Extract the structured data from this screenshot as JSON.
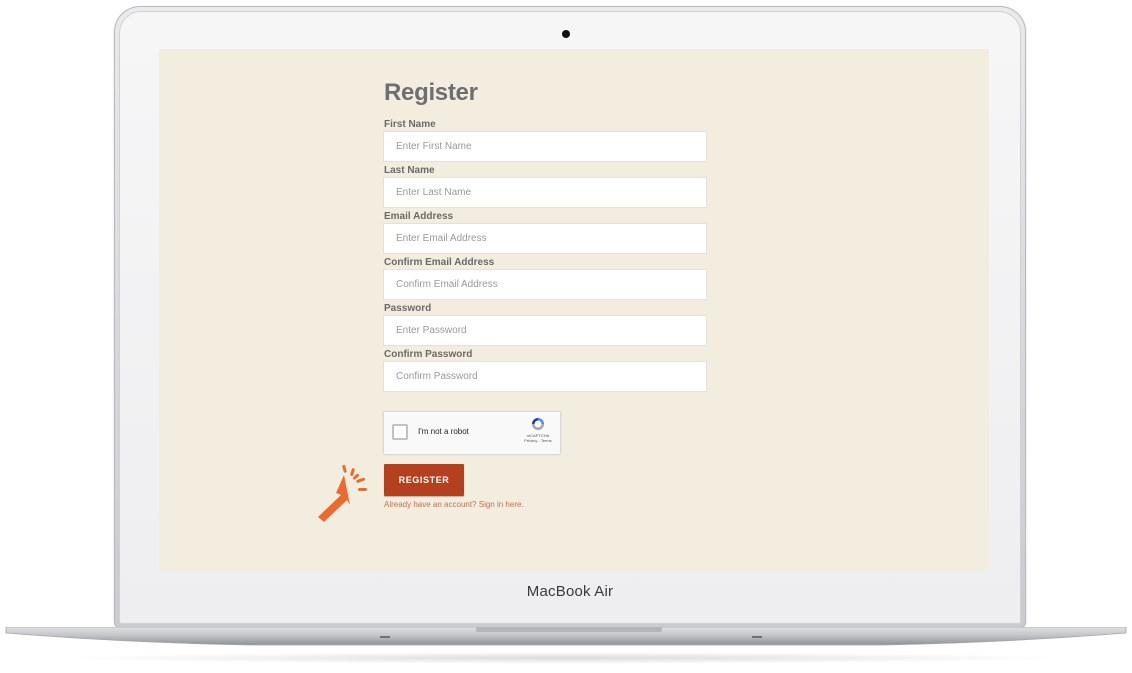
{
  "device": {
    "brand_label": "MacBook Air"
  },
  "form": {
    "title": "Register",
    "fields": [
      {
        "label": "First Name",
        "placeholder": "Enter First Name"
      },
      {
        "label": "Last Name",
        "placeholder": "Enter Last Name"
      },
      {
        "label": "Email Address",
        "placeholder": "Enter Email Address"
      },
      {
        "label": "Confirm Email Address",
        "placeholder": "Confirm Email Address"
      },
      {
        "label": "Password",
        "placeholder": "Enter Password"
      },
      {
        "label": "Confirm Password",
        "placeholder": "Confirm Password"
      }
    ],
    "recaptcha": {
      "label": "I'm not a robot",
      "brand": "reCAPTCHA",
      "terms": "Privacy - Terms"
    },
    "register_label": "REGISTER",
    "signin_text": "Already have an account? Sign in here."
  },
  "colors": {
    "page_background": "#f3ede0",
    "button": "#b5401f",
    "link": "#c8704c",
    "pointer": "#ec6a2d"
  },
  "icons": {
    "camera": "camera-dot",
    "pointer": "hand-pointer-icon",
    "recaptcha": "recaptcha-logo-icon"
  }
}
